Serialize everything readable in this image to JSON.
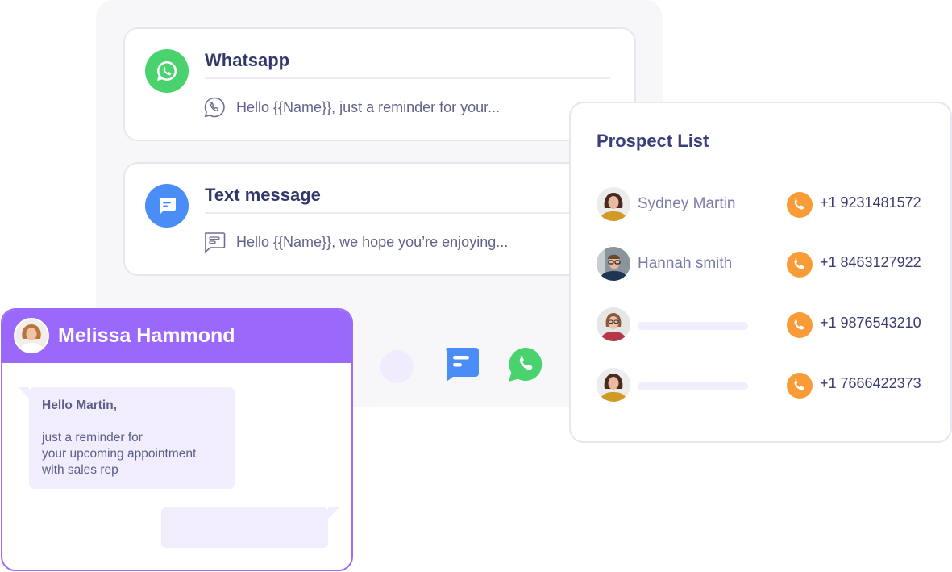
{
  "channels": [
    {
      "title": "Whatsapp",
      "icon": "whatsapp-icon",
      "preview_icon": "whatsapp-outline-icon",
      "preview": "Hello {{Name}}, just a reminder for your...",
      "color": "#4ad26f"
    },
    {
      "title": "Text message",
      "icon": "sms-icon",
      "preview_icon": "sms-outline-icon",
      "preview": "Hello {{Name}}, we hope you’re enjoying...",
      "color": "#4a8df6"
    }
  ],
  "prospect_list": {
    "title": "Prospect List",
    "accent": "#f99b37",
    "rows": [
      {
        "name": "Sydney Martin",
        "phone": "+1 9231481572"
      },
      {
        "name": "Hannah smith",
        "phone": "+1 8463127922"
      },
      {
        "name": "",
        "phone": "+1 9876543210"
      },
      {
        "name": "",
        "phone": "+1 7666422373"
      }
    ]
  },
  "chat": {
    "contact_name": "Melissa Hammond",
    "header_color": "#9b68fc",
    "incoming": {
      "greeting": "Hello Martin,",
      "body": [
        "just a reminder for",
        "your upcoming appointment",
        "with sales rep"
      ]
    }
  }
}
